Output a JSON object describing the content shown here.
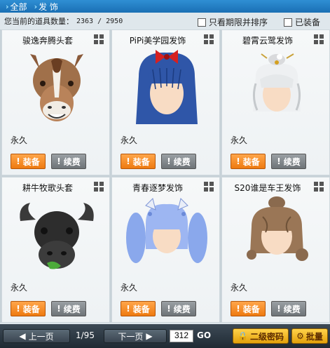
{
  "tabs": [
    {
      "label": "全部"
    },
    {
      "label": "发 饰"
    }
  ],
  "info": {
    "count_label": "您当前的道具数量：",
    "count_value": "2363 / 2950",
    "option_expiring": "只看期限并排序",
    "option_equipped": "已装备"
  },
  "items": [
    {
      "name": "骏逸奔腾头套",
      "duration": "永久",
      "equip_label": "装备",
      "renew_label": "续费"
    },
    {
      "name": "PiPi美学园发饰",
      "duration": "永久",
      "equip_label": "装备",
      "renew_label": "续费"
    },
    {
      "name": "碧霄云鹭发饰",
      "duration": "永久",
      "equip_label": "装备",
      "renew_label": "续费"
    },
    {
      "name": "耕牛牧歌头套",
      "duration": "永久",
      "equip_label": "装备",
      "renew_label": "续费"
    },
    {
      "name": "青春逐梦发饰",
      "duration": "永久",
      "equip_label": "装备",
      "renew_label": "续费"
    },
    {
      "name": "S20谁是车王发饰",
      "duration": "永久",
      "equip_label": "装备",
      "renew_label": "续费"
    }
  ],
  "pagination": {
    "prev_label": "上一页",
    "page_info": "1/95",
    "next_label": "下一页",
    "page_input": "312",
    "go_label": "GO"
  },
  "footer": {
    "password_label": "二级密码",
    "batch_label": "批量"
  },
  "colors": {
    "accent_orange": "#ee7a10",
    "tab_blue": "#1a6fb4",
    "gold": "#e3a10b"
  }
}
